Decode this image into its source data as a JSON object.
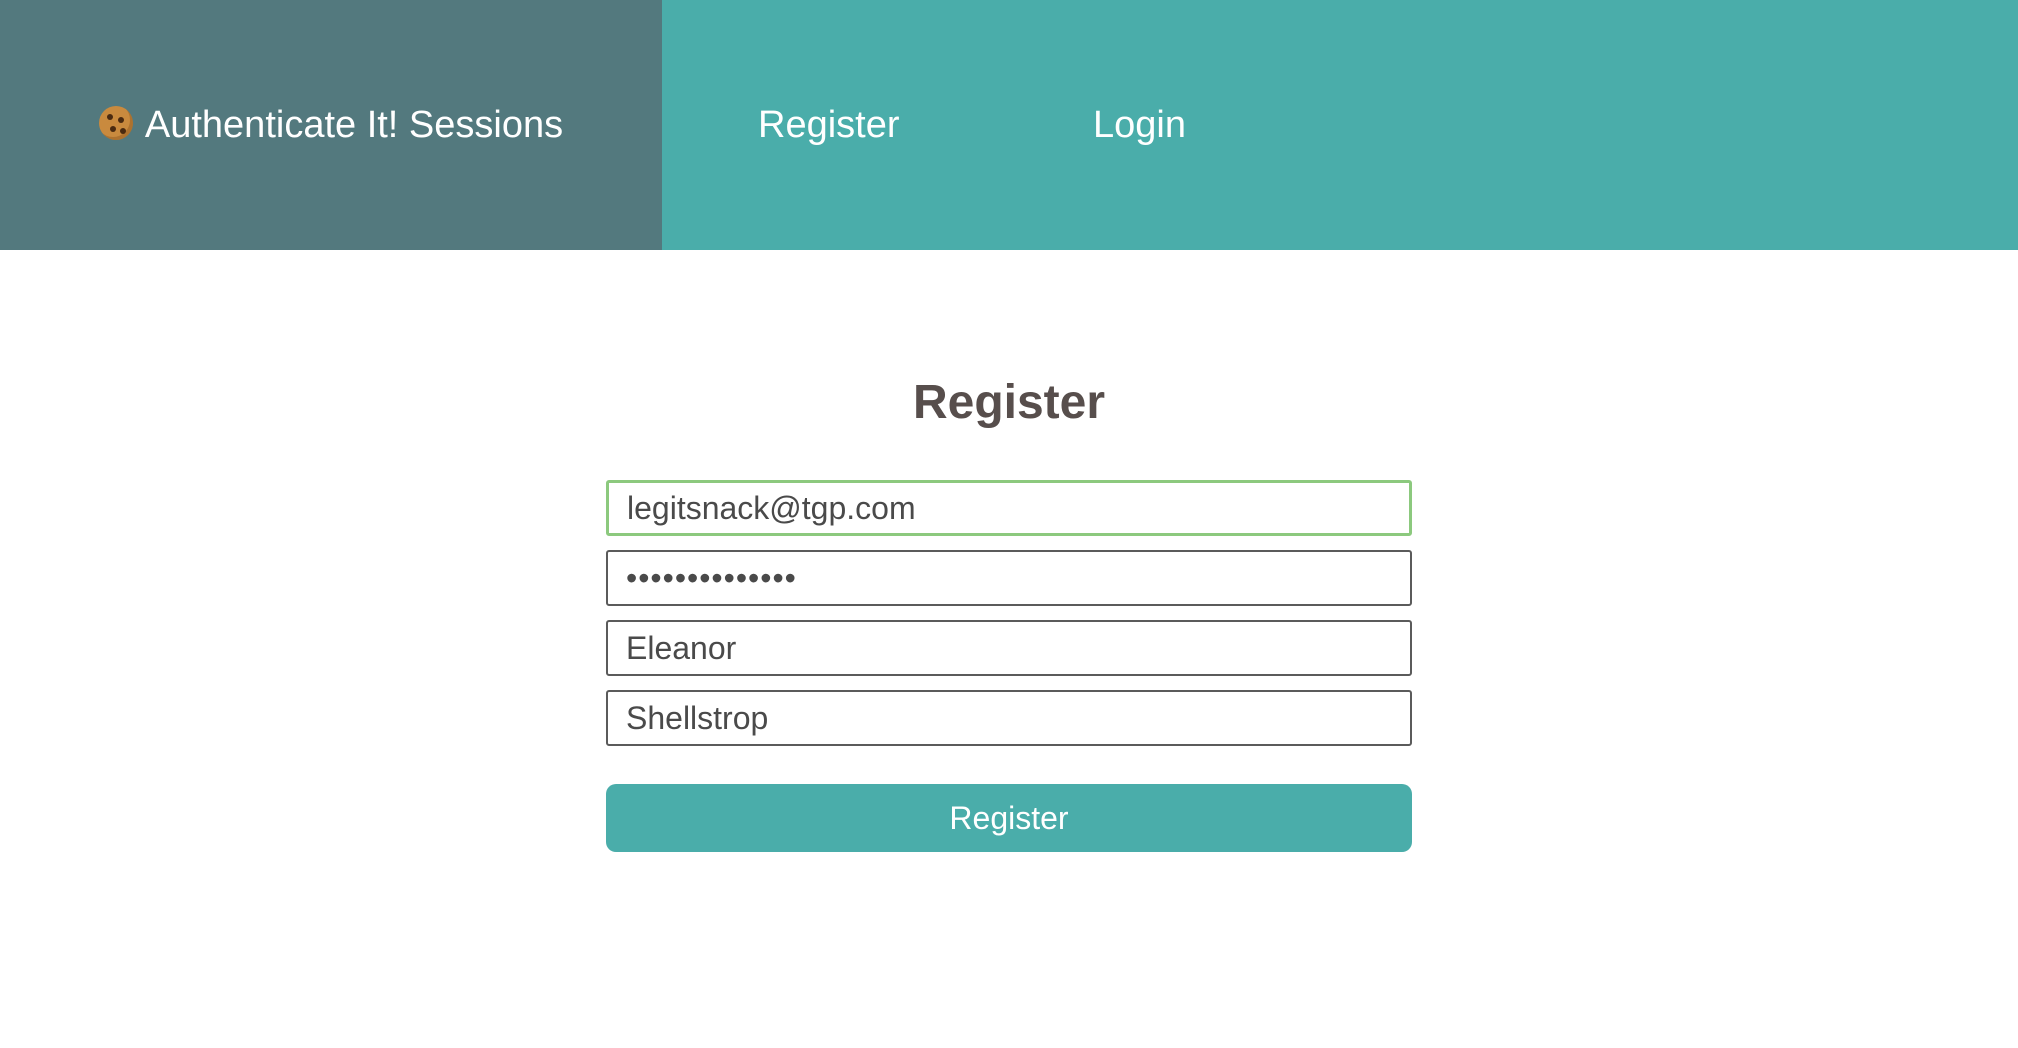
{
  "navbar": {
    "brand_label": "Authenticate It! Sessions",
    "brand_icon": "cookie-icon",
    "links": [
      {
        "label": "Register"
      },
      {
        "label": "Login"
      }
    ],
    "colors": {
      "bar": "#4aadaa",
      "brand_bg": "#53797e",
      "text": "#ffffff"
    }
  },
  "form": {
    "title": "Register",
    "email": {
      "value": "legitsnack@tgp.com"
    },
    "password": {
      "value": "••••••••••••••"
    },
    "first_name": {
      "value": "Eleanor"
    },
    "last_name": {
      "value": "Shellstrop"
    },
    "submit_label": "Register",
    "colors": {
      "focus_border": "#8cc97e",
      "button": "#4aadaa",
      "title": "#574e4c"
    }
  }
}
